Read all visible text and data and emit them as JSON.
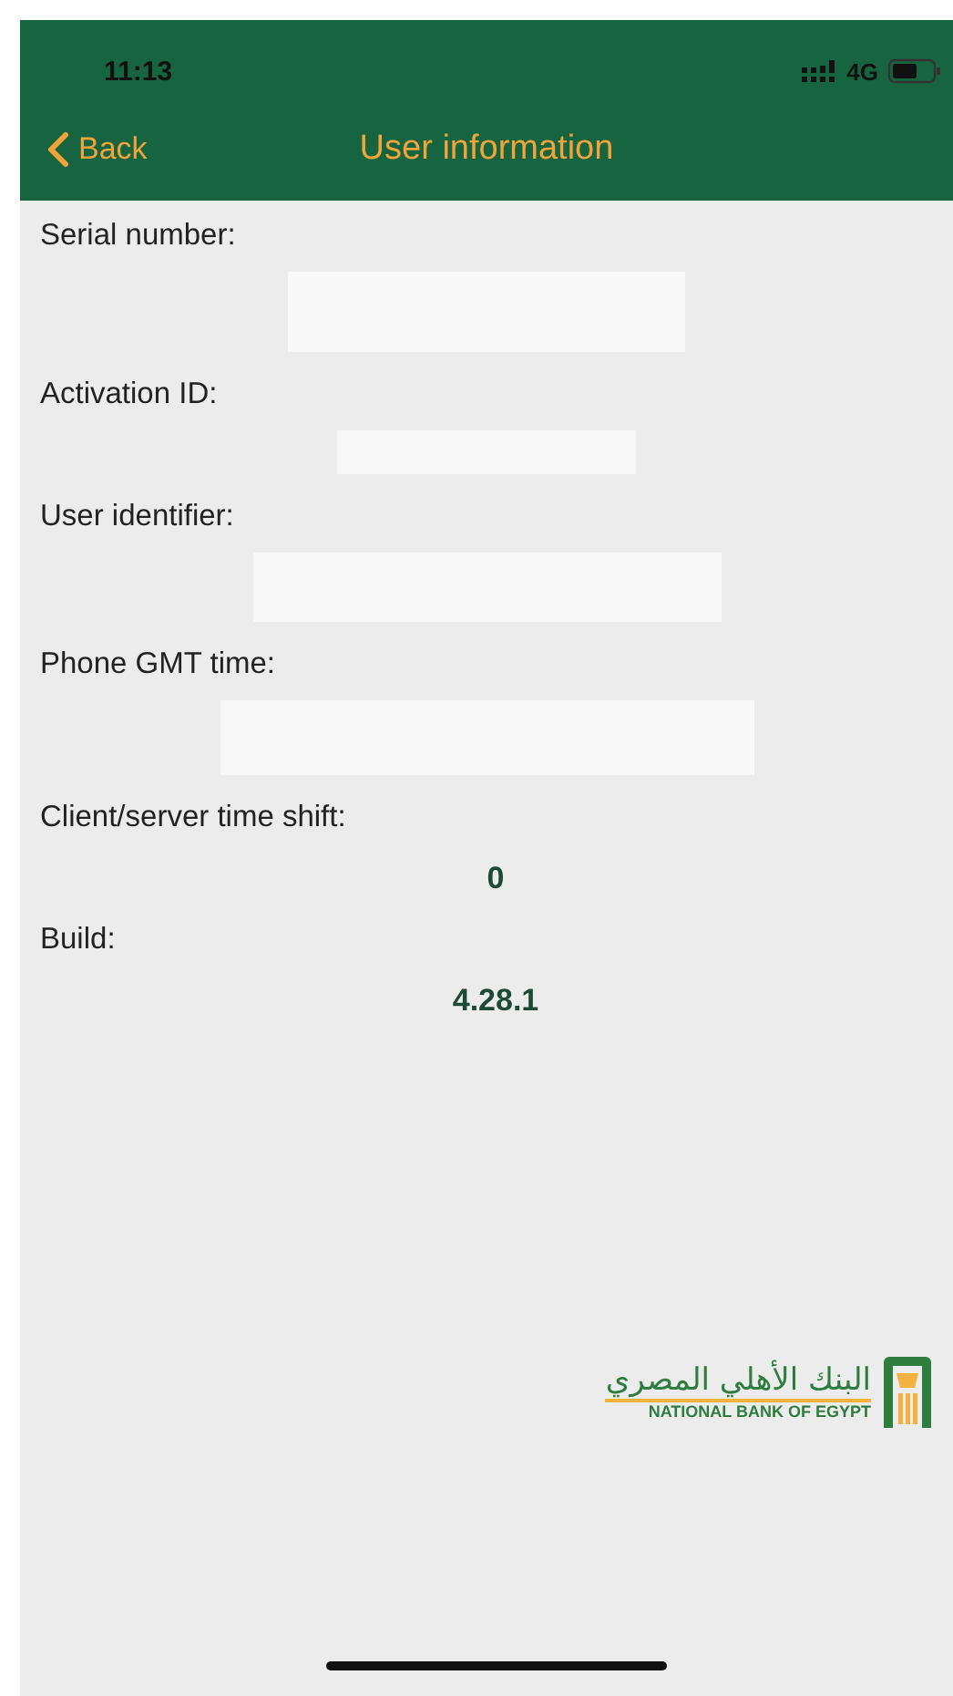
{
  "status_bar": {
    "time": "11:13",
    "network": "4G"
  },
  "nav": {
    "back": "Back",
    "title": "User information"
  },
  "fields": [
    {
      "label": "Serial number:",
      "kind": "redacted"
    },
    {
      "label": "Activation ID:",
      "kind": "redacted"
    },
    {
      "label": "User identifier:",
      "kind": "redacted"
    },
    {
      "label": "Phone GMT time:",
      "kind": "redacted"
    },
    {
      "label": "Client/server time shift:",
      "kind": "text",
      "value": "0"
    },
    {
      "label": "Build:",
      "kind": "text",
      "value": "4.28.1"
    }
  ],
  "logo": {
    "arabic": "البنك الأهلي المصري",
    "english": "NATIONAL BANK OF EGYPT"
  }
}
